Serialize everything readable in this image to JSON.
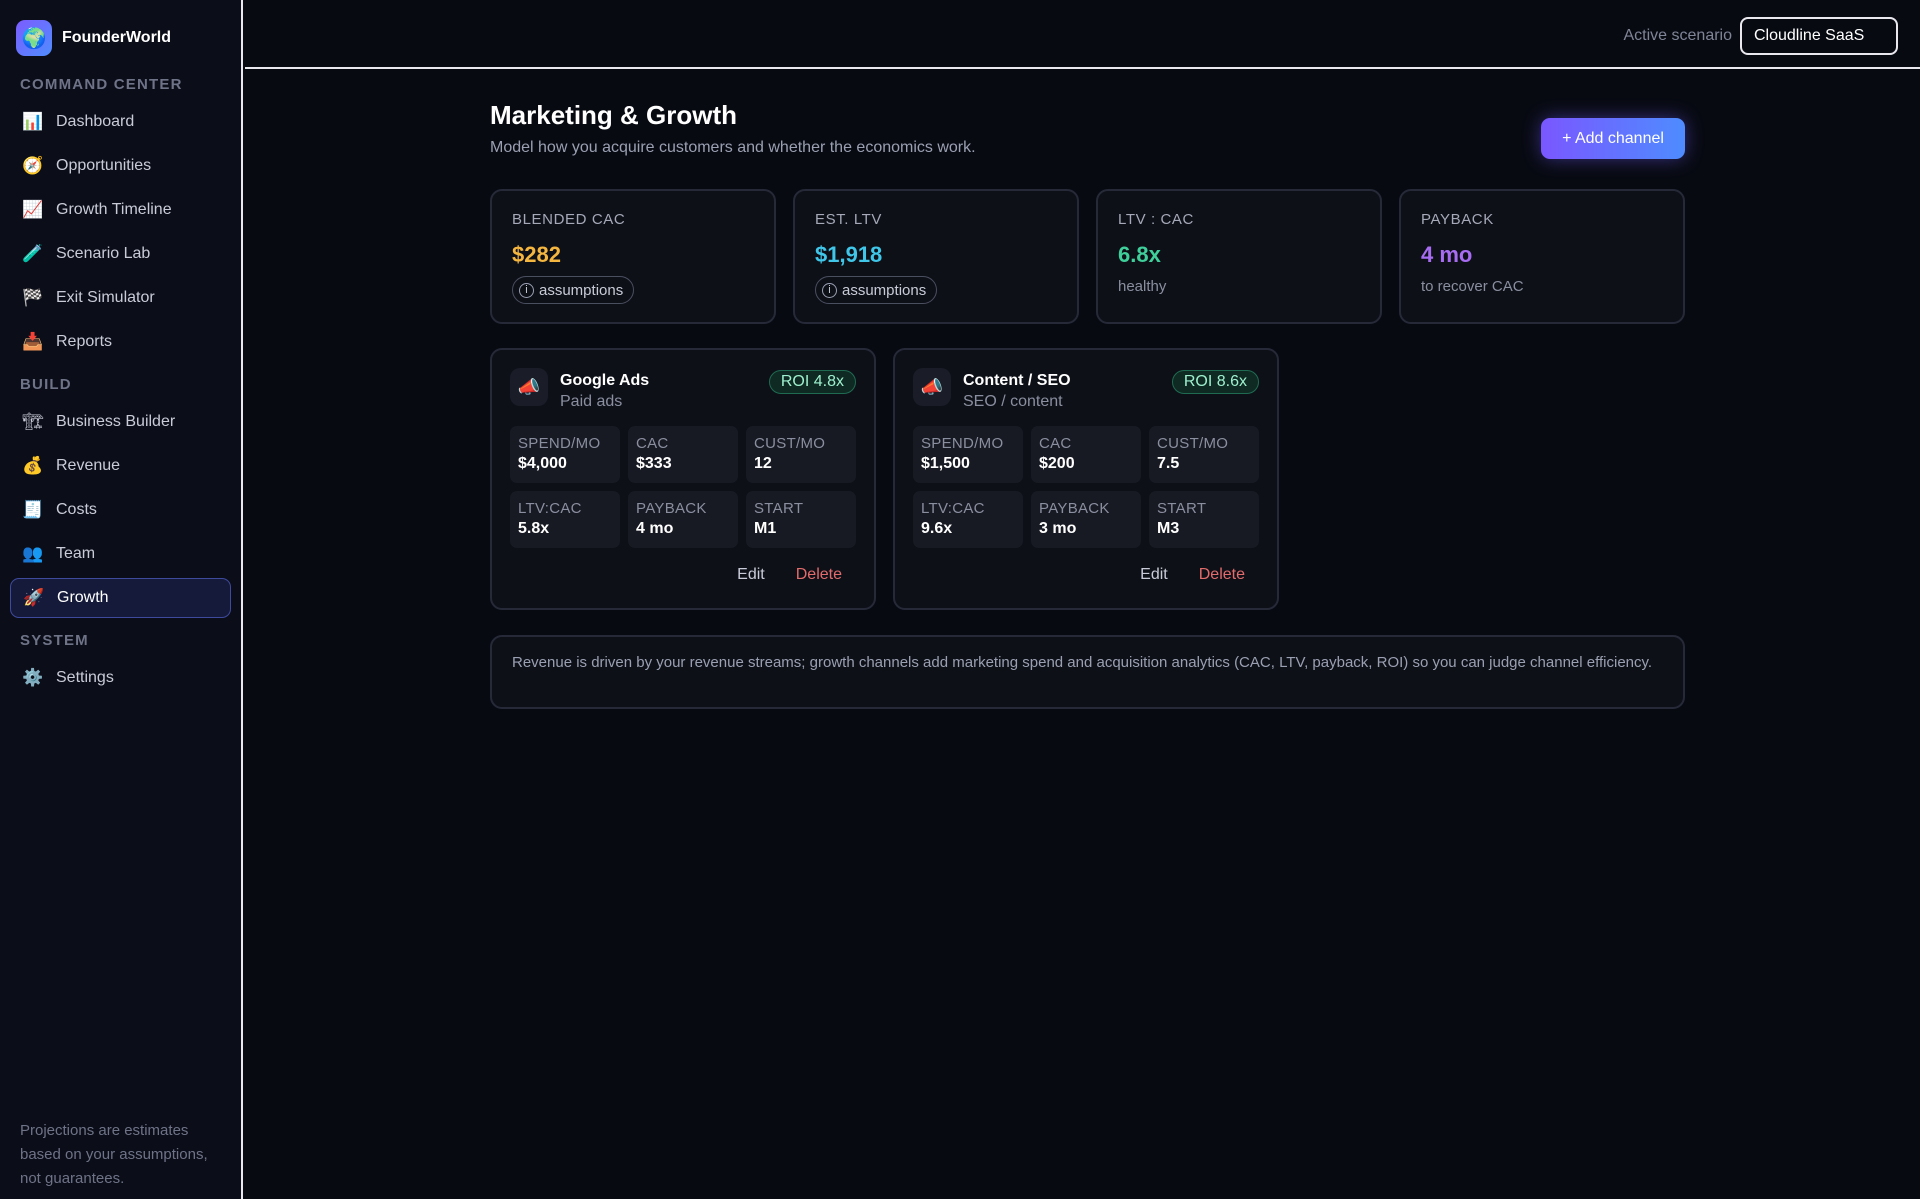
{
  "app": {
    "name": "FounderWorld",
    "logo_icon": "globe-icon"
  },
  "sidebar": {
    "sections": [
      {
        "label": "COMMAND CENTER",
        "items": [
          {
            "label": "Dashboard",
            "icon": "📊"
          },
          {
            "label": "Opportunities",
            "icon": "🧭"
          },
          {
            "label": "Growth Timeline",
            "icon": "📈"
          },
          {
            "label": "Scenario Lab",
            "icon": "🧪"
          },
          {
            "label": "Exit Simulator",
            "icon": "🏁"
          },
          {
            "label": "Reports",
            "icon": "📥"
          }
        ]
      },
      {
        "label": "BUILD",
        "items": [
          {
            "label": "Business Builder",
            "icon": "🏗"
          },
          {
            "label": "Revenue",
            "icon": "💰"
          },
          {
            "label": "Costs",
            "icon": "🧾"
          },
          {
            "label": "Team",
            "icon": "👥"
          },
          {
            "label": "Growth",
            "icon": "🚀"
          }
        ]
      },
      {
        "label": "SYSTEM",
        "items": [
          {
            "label": "Settings",
            "icon": "⚙️"
          }
        ]
      }
    ],
    "active_item": "Growth",
    "footer": "Projections are estimates based on your assumptions, not guarantees."
  },
  "topbar": {
    "scenario_label": "Active scenario",
    "scenario_value": "Cloudline SaaS"
  },
  "page": {
    "title": "Marketing & Growth",
    "subtitle": "Model how you acquire customers and whether the economics work.",
    "add_button": "+ Add channel"
  },
  "kpis": [
    {
      "label": "BLENDED CAC",
      "value": "$282",
      "color": "#f5b640",
      "pill": "assumptions"
    },
    {
      "label": "EST. LTV",
      "value": "$1,918",
      "color": "#3fc6e8",
      "pill": "assumptions"
    },
    {
      "label": "LTV : CAC",
      "value": "6.8x",
      "color": "#3ecf9b",
      "note": "healthy"
    },
    {
      "label": "PAYBACK",
      "value": "4 mo",
      "color": "#a76cf2",
      "note": "to recover CAC"
    }
  ],
  "channels": [
    {
      "name": "Google Ads",
      "type": "Paid ads",
      "roi": "ROI 4.8x",
      "icon": "📣",
      "stats": [
        {
          "label": "SPEND/MO",
          "value": "$4,000"
        },
        {
          "label": "CAC",
          "value": "$333"
        },
        {
          "label": "CUST/MO",
          "value": "12"
        },
        {
          "label": "LTV:CAC",
          "value": "5.8x"
        },
        {
          "label": "PAYBACK",
          "value": "4 mo"
        },
        {
          "label": "START",
          "value": "M1"
        }
      ],
      "edit": "Edit",
      "delete": "Delete"
    },
    {
      "name": "Content / SEO",
      "type": "SEO / content",
      "roi": "ROI 8.6x",
      "icon": "📣",
      "stats": [
        {
          "label": "SPEND/MO",
          "value": "$1,500"
        },
        {
          "label": "CAC",
          "value": "$200"
        },
        {
          "label": "CUST/MO",
          "value": "7.5"
        },
        {
          "label": "LTV:CAC",
          "value": "9.6x"
        },
        {
          "label": "PAYBACK",
          "value": "3 mo"
        },
        {
          "label": "START",
          "value": "M3"
        }
      ],
      "edit": "Edit",
      "delete": "Delete"
    }
  ],
  "info_text": "Revenue is driven by your revenue streams; growth channels add marketing spend and acquisition analytics (CAC, LTV, payback, ROI) so you can judge channel efficiency."
}
